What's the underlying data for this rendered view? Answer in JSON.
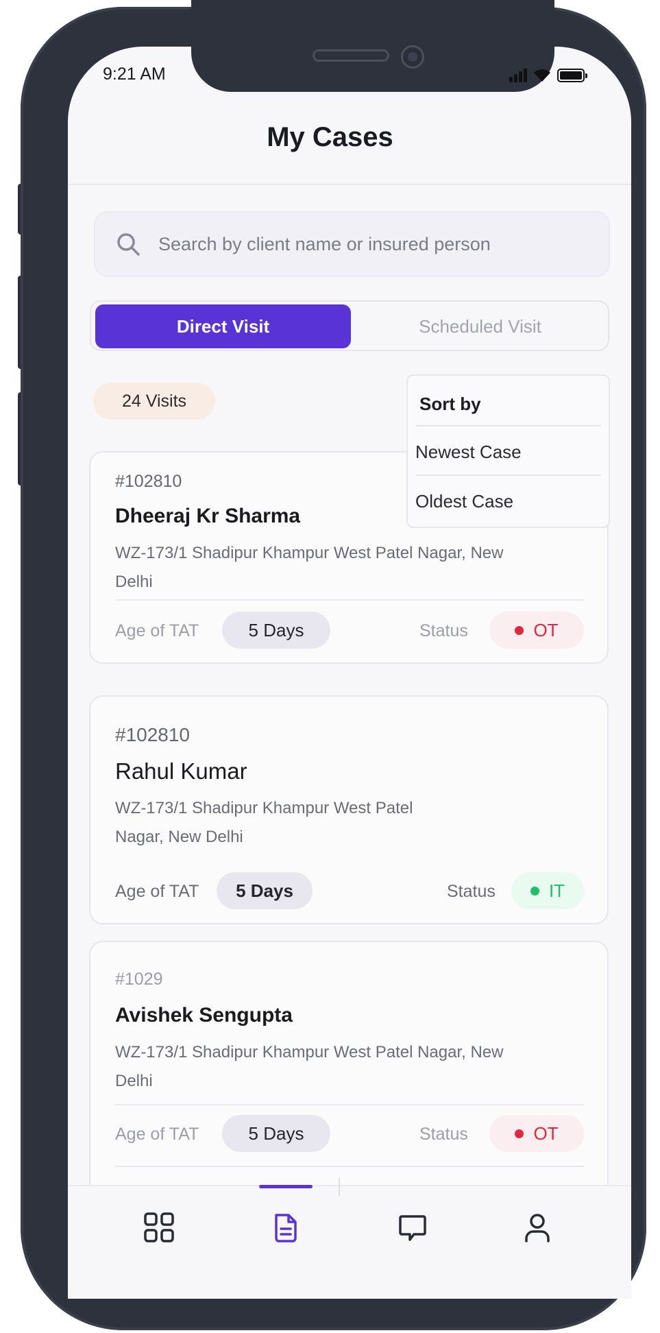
{
  "status_bar": {
    "time": "9:21 AM"
  },
  "header": {
    "title": "My Cases"
  },
  "search": {
    "placeholder": "Search by client name or insured person"
  },
  "tabs": {
    "active": "Direct Visit",
    "inactive": "Scheduled Visit"
  },
  "visits_count": "24 Visits",
  "sort_menu": {
    "title": "Sort by",
    "options": [
      "Newest Case",
      "Oldest Case"
    ]
  },
  "cases": [
    {
      "id": "#102810",
      "name": "Dheeraj Kr Sharma",
      "address_line1": "WZ-173/1 Shadipur Khampur West Patel Nagar, New",
      "address_line2": "Delhi",
      "tat_label": "Age of TAT",
      "tat_value": "5 Days",
      "status_label": "Status",
      "status": "OT"
    },
    {
      "id": "#102810",
      "name": "Rahul Kumar",
      "address_line1": "WZ-173/1 Shadipur Khampur West Patel",
      "address_line2": "Nagar, New Delhi",
      "tat_label": "Age of TAT",
      "tat_value": "5 Days",
      "status_label": "Status",
      "status": "IT"
    },
    {
      "id": "#1029",
      "name": "Avishek Sengupta",
      "address_line1": "WZ-173/1 Shadipur Khampur West Patel Nagar, New",
      "address_line2": "Delhi",
      "tat_label": "Age of TAT",
      "tat_value": "5 Days",
      "status_label": "Status",
      "status": "OT"
    }
  ],
  "bottom_nav": {
    "items": [
      "dashboard-grid-icon",
      "document-icon",
      "chat-icon",
      "profile-icon"
    ],
    "active_index": 1
  },
  "colors": {
    "accent": "#5a33d6",
    "status_ot": "#e0283e",
    "status_it": "#20c068",
    "frame": "#2d323d"
  }
}
